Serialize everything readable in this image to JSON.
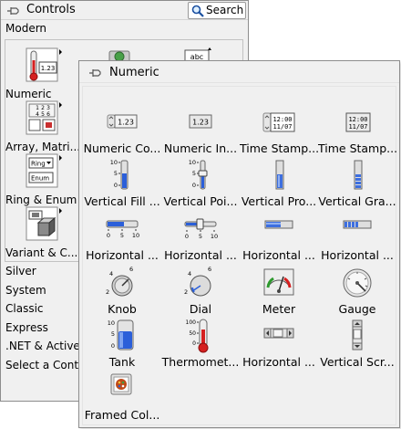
{
  "controls_palette": {
    "title": "Controls",
    "search_label": "Search",
    "section": "Modern",
    "categories": [
      {
        "label": "Numeric",
        "icon": "numeric-category-icon"
      },
      {
        "label": "Array, Matri...",
        "icon": "array-matrix-category-icon"
      },
      {
        "label": "Ring & Enum",
        "icon": "ring-enum-category-icon"
      },
      {
        "label": "Variant & C...",
        "icon": "variant-class-category-icon"
      }
    ],
    "sub_palettes": [
      "Silver",
      "System",
      "Classic",
      "Express",
      ".NET & ActiveX",
      "Select a Control..."
    ]
  },
  "numeric_palette": {
    "title": "Numeric",
    "items": [
      {
        "label": "Numeric Co...",
        "icon": "numeric-control-icon"
      },
      {
        "label": "Numeric In...",
        "icon": "numeric-indicator-icon"
      },
      {
        "label": "Time Stamp...",
        "icon": "time-stamp-control-icon"
      },
      {
        "label": "Time Stamp...",
        "icon": "time-stamp-indicator-icon"
      },
      {
        "label": "Vertical Fill ...",
        "icon": "vertical-fill-slide-icon"
      },
      {
        "label": "Vertical Poi...",
        "icon": "vertical-pointer-slide-icon"
      },
      {
        "label": "Vertical Pro...",
        "icon": "vertical-progress-bar-icon"
      },
      {
        "label": "Vertical Gra...",
        "icon": "vertical-graduated-bar-icon"
      },
      {
        "label": "Horizontal ...",
        "icon": "horizontal-fill-slide-icon"
      },
      {
        "label": "Horizontal ...",
        "icon": "horizontal-pointer-slide-icon"
      },
      {
        "label": "Horizontal ...",
        "icon": "horizontal-progress-bar-icon"
      },
      {
        "label": "Horizontal ...",
        "icon": "horizontal-graduated-bar-icon"
      },
      {
        "label": "Knob",
        "icon": "knob-icon"
      },
      {
        "label": "Dial",
        "icon": "dial-icon"
      },
      {
        "label": "Meter",
        "icon": "meter-icon"
      },
      {
        "label": "Gauge",
        "icon": "gauge-icon"
      },
      {
        "label": "Tank",
        "icon": "tank-icon"
      },
      {
        "label": "Thermomet...",
        "icon": "thermometer-icon"
      },
      {
        "label": "Horizontal ...",
        "icon": "horizontal-scrollbar-icon"
      },
      {
        "label": "Vertical Scr...",
        "icon": "vertical-scrollbar-icon"
      },
      {
        "label": "Framed Col...",
        "icon": "framed-color-box-icon"
      }
    ]
  },
  "icon_text": {
    "numeric_value": "1.23",
    "string_value": "abc",
    "time": "12:00",
    "date": "11/07",
    "ring": "Ring",
    "enum": "Enum",
    "slide_ticks": [
      "10",
      "5",
      "0"
    ],
    "horizontal_ticks": [
      "0",
      "5",
      "10"
    ],
    "thermo_ticks": [
      "100",
      "50",
      "0"
    ],
    "knob_ticks": [
      "4",
      "6",
      "2"
    ],
    "array_cells": [
      "1",
      "2",
      "3",
      "4",
      "5",
      "6"
    ]
  },
  "colors": {
    "window_bg": "#f0f0f0",
    "border": "#8d8d8d",
    "fill_blue": "#2b5fd9",
    "thermo_red": "#d52020"
  }
}
